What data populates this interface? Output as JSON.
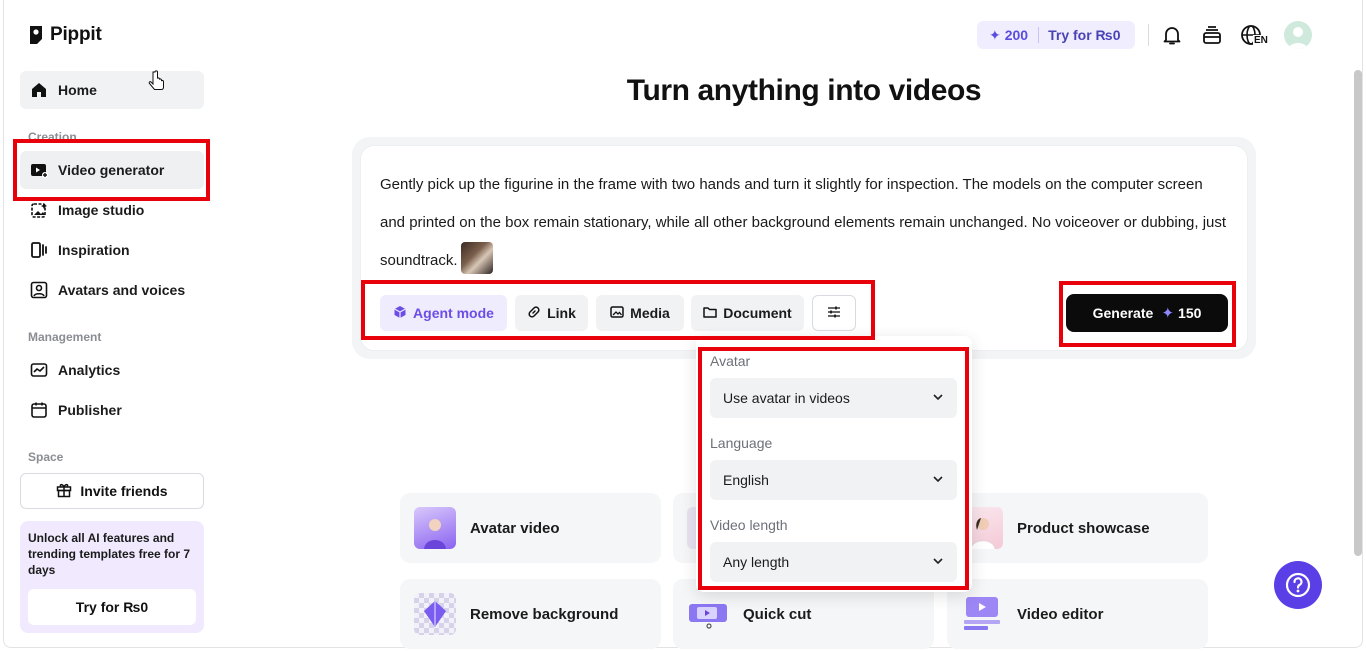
{
  "app": {
    "name": "Pippit"
  },
  "sidebar": {
    "home_label": "Home",
    "creation_label": "Creation",
    "creation_items": [
      {
        "label": "Video generator",
        "icon": "video-plus-icon"
      },
      {
        "label": "Image studio",
        "icon": "image-sparkle-icon"
      },
      {
        "label": "Inspiration",
        "icon": "inspiration-icon"
      },
      {
        "label": "Avatars and voices",
        "icon": "avatar-icon"
      }
    ],
    "management_label": "Management",
    "management_items": [
      {
        "label": "Analytics",
        "icon": "chart-icon"
      },
      {
        "label": "Publisher",
        "icon": "calendar-icon"
      }
    ],
    "space_label": "Space",
    "invite_label": "Invite friends",
    "promo": {
      "text": "Unlock all AI features and trending templates free for 7 days",
      "button": "Try for ₨0"
    }
  },
  "header": {
    "credits": "200",
    "try_label": "Try for ₨0",
    "language_badge": "EN"
  },
  "main": {
    "title": "Turn anything into videos",
    "prompt": "Gently pick up the figurine in the frame with two hands and turn it slightly for inspection. The models on the computer screen and printed on the box remain stationary, while all other background elements remain unchanged. No voiceover or dubbing, just soundtrack.",
    "tools": {
      "agent_mode": "Agent mode",
      "link": "Link",
      "media": "Media",
      "document": "Document"
    },
    "generate": {
      "label": "Generate",
      "cost": "150"
    }
  },
  "settings_popup": {
    "avatar_label": "Avatar",
    "avatar_value": "Use avatar in videos",
    "language_label": "Language",
    "language_value": "English",
    "length_label": "Video length",
    "length_value": "Any length"
  },
  "cards": [
    {
      "label": "Avatar video"
    },
    {
      "label": "Product showcase"
    },
    {
      "label": "Remove background"
    },
    {
      "label": "Quick cut"
    },
    {
      "label": "Video editor"
    }
  ],
  "colors": {
    "accent": "#5a3ee6",
    "highlight_box": "#e8000a",
    "agent_text": "#6c4ee6"
  }
}
